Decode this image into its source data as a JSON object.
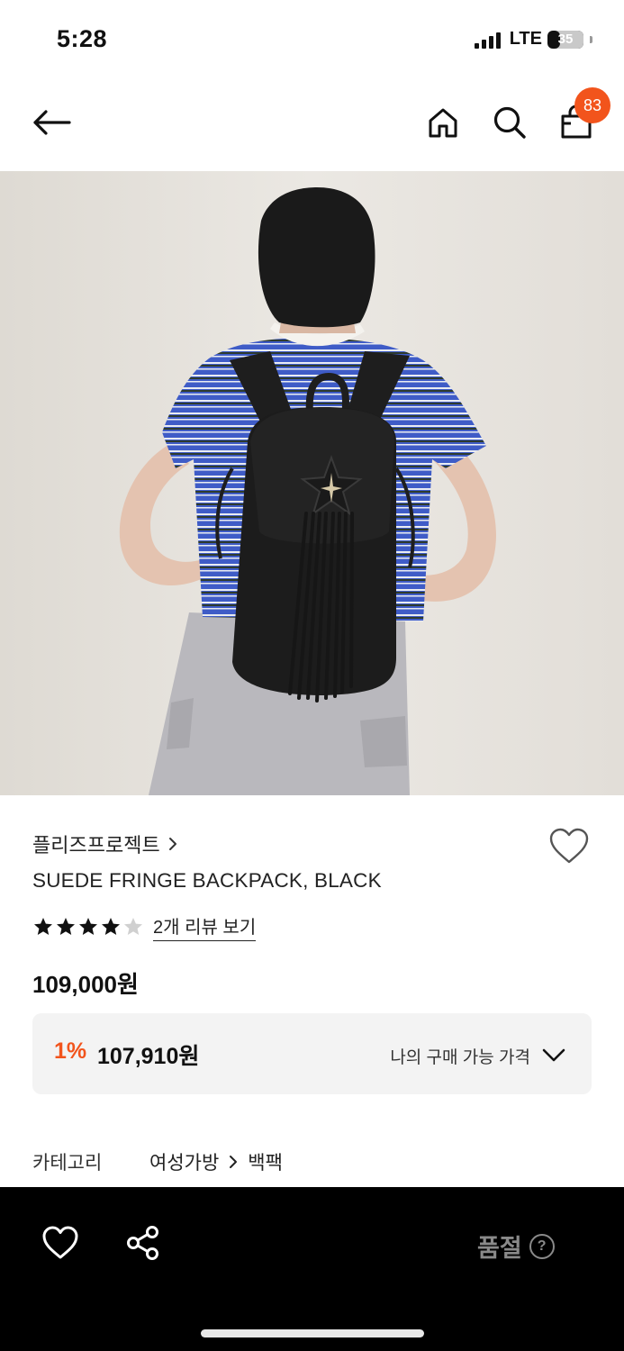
{
  "status_bar": {
    "time": "5:28",
    "network": "LTE",
    "battery": "35"
  },
  "nav": {
    "cart_count": "83"
  },
  "product": {
    "brand": "플리즈프로젝트",
    "name": "SUEDE FRINGE BACKPACK, BLACK",
    "rating": 4,
    "rating_max": 5,
    "review_link": "2개 리뷰 보기",
    "price": "109,000원",
    "discount_percent": "1%",
    "discount_price": "107,910원",
    "my_price_label": "나의 구매 가능 가격",
    "category_label": "카테고리",
    "category_path": [
      "여성가방",
      "백팩"
    ]
  },
  "bottom_bar": {
    "soldout_label": "품절",
    "help_symbol": "?"
  },
  "colors": {
    "accent": "#f2541c",
    "bottom_bar": "#000000",
    "price_box": "#f3f3f3"
  },
  "icons": [
    "back-arrow-icon",
    "home-icon",
    "search-icon",
    "shopping-bag-icon",
    "heart-icon",
    "share-icon",
    "chevron-down-icon",
    "chevron-right-icon",
    "star-icon",
    "help-icon"
  ]
}
